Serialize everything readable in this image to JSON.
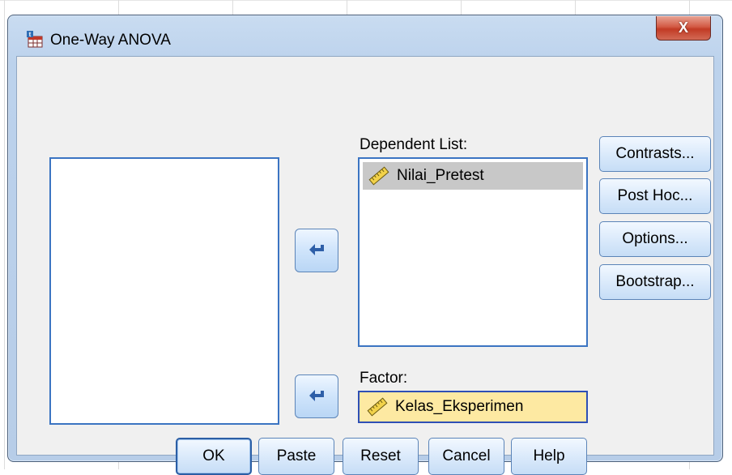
{
  "window": {
    "title": "One-Way ANOVA",
    "close_label": "X",
    "app_icon": "spss-dialog-icon",
    "close_icon": "close-icon"
  },
  "source_list": {
    "items": []
  },
  "dependent_list": {
    "label": "Dependent List:",
    "items": [
      {
        "label": "Nilai_Pretest",
        "icon": "scale-ruler-icon",
        "selected": true
      }
    ]
  },
  "factor": {
    "label": "Factor:",
    "value": "Kelas_Eksperimen",
    "icon": "scale-ruler-icon"
  },
  "move_buttons": [
    {
      "icon": "arrow-left-icon",
      "target": "dependent_list"
    },
    {
      "icon": "arrow-left-icon",
      "target": "factor"
    }
  ],
  "side_buttons": {
    "contrasts": "Contrasts...",
    "post_hoc": "Post Hoc...",
    "options": "Options...",
    "bootstrap": "Bootstrap..."
  },
  "bottom_buttons": {
    "ok": "OK",
    "paste": "Paste",
    "reset": "Reset",
    "cancel": "Cancel",
    "help": "Help"
  },
  "colors": {
    "frame": "#bcd2ec",
    "client": "#f0f0f0",
    "list_border": "#3b74c2",
    "factor_fill": "#fde9a2",
    "selection": "#c8c8c8",
    "close_red": "#c23b25"
  }
}
